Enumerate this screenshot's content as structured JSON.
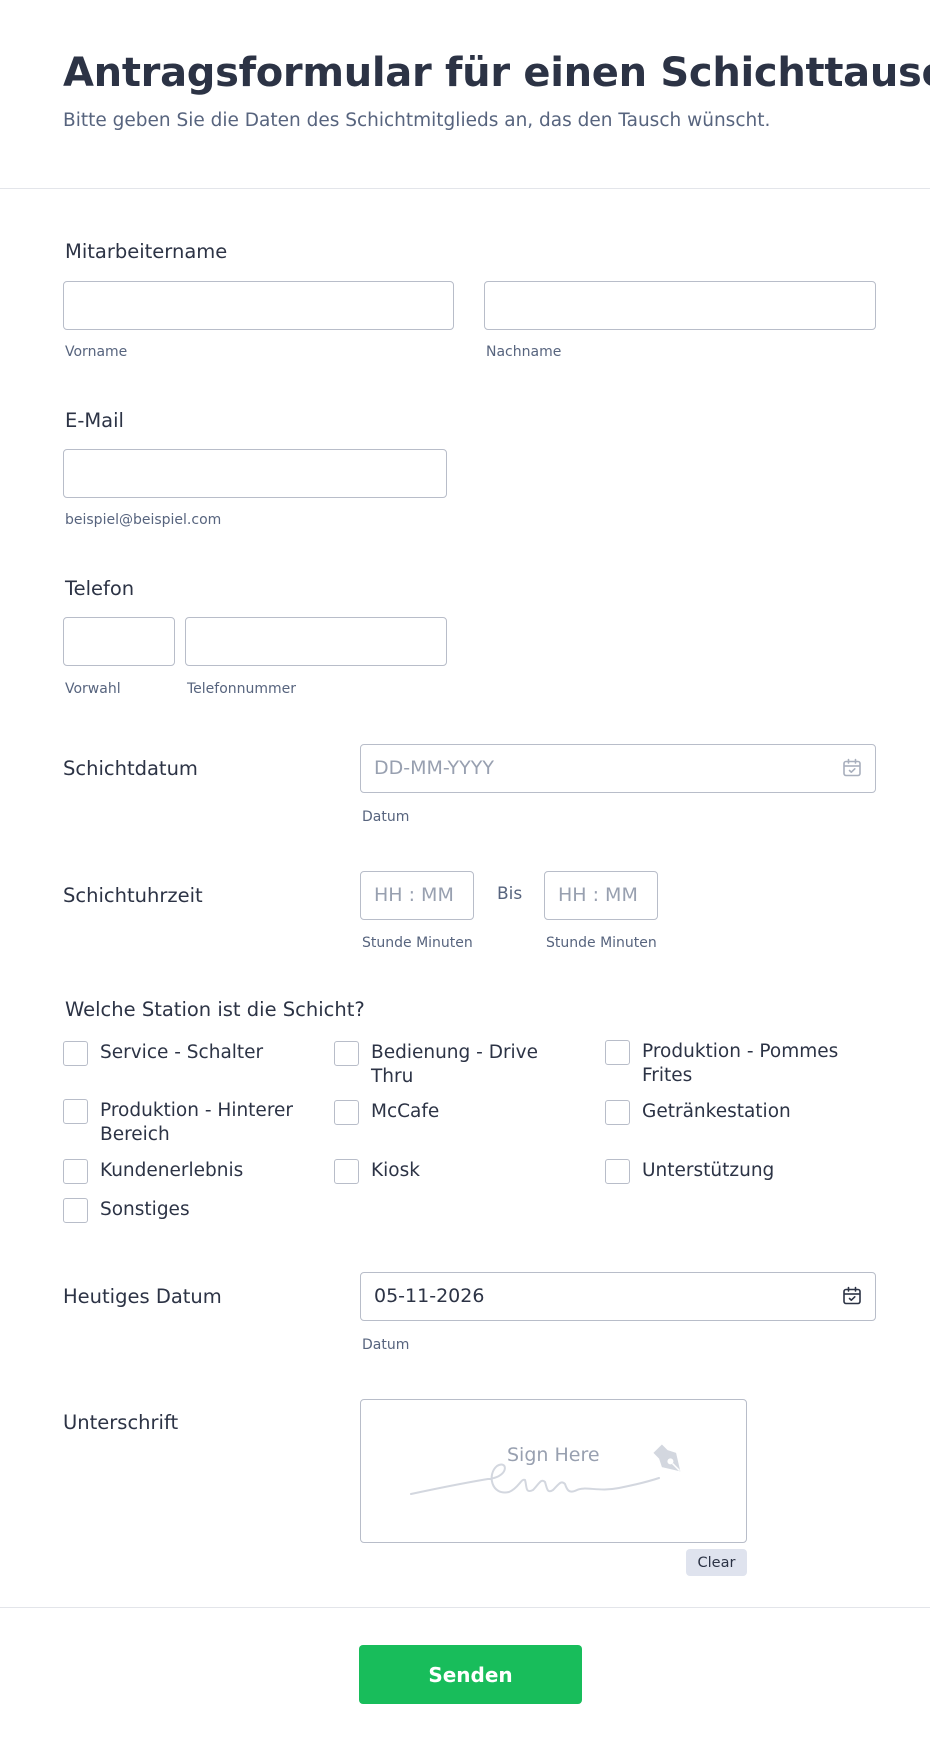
{
  "header": {
    "title": "Antragsformular für einen Schichttausch",
    "subtitle": "Bitte geben Sie die Daten des Schichtmitglieds an, das den Tausch wünscht."
  },
  "employee_name": {
    "label": "Mitarbeitername",
    "first_sublabel": "Vorname",
    "last_sublabel": "Nachname",
    "first_value": "",
    "last_value": ""
  },
  "email": {
    "label": "E-Mail",
    "value": "",
    "sublabel": "beispiel@beispiel.com"
  },
  "phone": {
    "label": "Telefon",
    "area_sublabel": "Vorwahl",
    "number_sublabel": "Telefonnummer",
    "area_value": "",
    "number_value": ""
  },
  "shift_date": {
    "label": "Schichtdatum",
    "placeholder": "DD-MM-YYYY",
    "sublabel": "Datum",
    "icon": "calendar-icon"
  },
  "shift_time": {
    "label": "Schichtuhrzeit",
    "from_placeholder": "HH : MM",
    "to_placeholder": "HH : MM",
    "separator": "Bis",
    "from_sublabel": "Stunde Minuten",
    "to_sublabel": "Stunde Minuten"
  },
  "station": {
    "label": "Welche Station ist die Schicht?",
    "options": [
      {
        "label": "Service - Schalter",
        "checked": false
      },
      {
        "label": "Bedienung - Drive Thru",
        "checked": false
      },
      {
        "label": "Produktion - Pommes Frites",
        "checked": false
      },
      {
        "label": "Produktion - Hinterer Bereich",
        "checked": false
      },
      {
        "label": "McCafe",
        "checked": false
      },
      {
        "label": "Getränkestation",
        "checked": false
      },
      {
        "label": "Kundenerlebnis",
        "checked": false
      },
      {
        "label": "Kiosk",
        "checked": false
      },
      {
        "label": "Unterstützung",
        "checked": false
      },
      {
        "label": "Sonstiges",
        "checked": false
      }
    ]
  },
  "today_date": {
    "label": "Heutiges Datum",
    "value": "05-11-2026",
    "sublabel": "Datum",
    "icon": "calendar-icon"
  },
  "signature": {
    "label": "Unterschrift",
    "placeholder": "Sign Here",
    "clear_label": "Clear",
    "icon": "pen-nib-icon"
  },
  "submit": {
    "label": "Senden",
    "color": "#18bd5b"
  }
}
